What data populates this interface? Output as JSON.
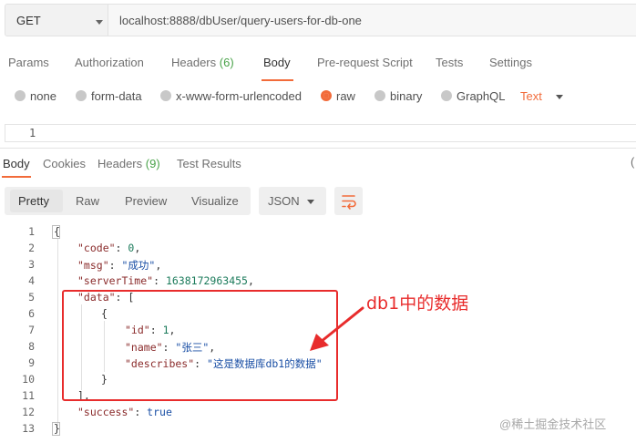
{
  "request": {
    "method": "GET",
    "url": "localhost:8888/dbUser/query-users-for-db-one"
  },
  "request_tabs": [
    {
      "label": "Params"
    },
    {
      "label": "Authorization"
    },
    {
      "label": "Headers",
      "count": "(6)"
    },
    {
      "label": "Body",
      "active": true
    },
    {
      "label": "Pre-request Script"
    },
    {
      "label": "Tests"
    },
    {
      "label": "Settings"
    }
  ],
  "body_types": [
    {
      "label": "none"
    },
    {
      "label": "form-data"
    },
    {
      "label": "x-www-form-urlencoded"
    },
    {
      "label": "raw",
      "selected": true
    },
    {
      "label": "binary"
    },
    {
      "label": "GraphQL"
    }
  ],
  "raw_format": "Text",
  "request_editor": {
    "line_number": "1"
  },
  "response_tabs": [
    {
      "label": "Body",
      "active": true
    },
    {
      "label": "Cookies"
    },
    {
      "label": "Headers",
      "count": "(9)"
    },
    {
      "label": "Test Results"
    }
  ],
  "response_edge_glyph": "(",
  "view_modes": [
    {
      "label": "Pretty",
      "active": true
    },
    {
      "label": "Raw"
    },
    {
      "label": "Preview"
    },
    {
      "label": "Visualize"
    }
  ],
  "response_format": "JSON",
  "response_lines": [
    {
      "n": "1",
      "t": "{"
    },
    {
      "n": "2",
      "t": "\"code\": 0,"
    },
    {
      "n": "3",
      "t": "\"msg\": \"成功\","
    },
    {
      "n": "4",
      "t": "\"serverTime\": 1638172963455,"
    },
    {
      "n": "5",
      "t": "\"data\": ["
    },
    {
      "n": "6",
      "t": "{"
    },
    {
      "n": "7",
      "t": "\"id\": 1,"
    },
    {
      "n": "8",
      "t": "\"name\": \"张三\","
    },
    {
      "n": "9",
      "t": "\"describes\": \"这是数据库db1的数据\""
    },
    {
      "n": "10",
      "t": "}"
    },
    {
      "n": "11",
      "t": "],"
    },
    {
      "n": "12",
      "t": "\"success\": true"
    },
    {
      "n": "13",
      "t": "}"
    }
  ],
  "response_tokens": {
    "code_key": "\"code\"",
    "code_val": "0",
    "msg_key": "\"msg\"",
    "msg_val": "\"成功\"",
    "time_key": "\"serverTime\"",
    "time_val": "1638172963455",
    "data_key": "\"data\"",
    "id_key": "\"id\"",
    "id_val": "1",
    "name_key": "\"name\"",
    "name_val": "\"张三\"",
    "desc_key": "\"describes\"",
    "desc_val": "\"这是数据库db1的数据\"",
    "success_key": "\"success\"",
    "success_val": "true",
    "colon": ": ",
    "comma": ",",
    "open_brace": "{",
    "close_brace": "}",
    "open_bracket": "[",
    "close_bracket_comma": "],"
  },
  "annotation": {
    "text": "db1中的数据",
    "color": "#e82c2c"
  },
  "watermark": "@稀土掘金技术社区",
  "colors": {
    "accent": "#f26b3a",
    "count_green": "#4aa34a"
  }
}
